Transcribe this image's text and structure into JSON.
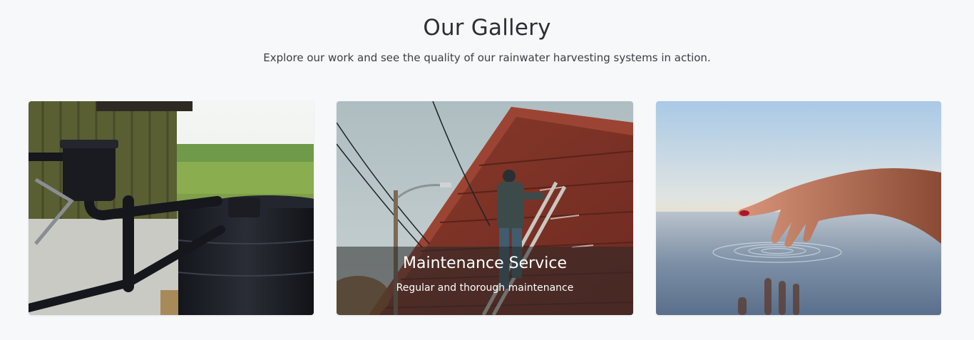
{
  "gallery": {
    "title": "Our Gallery",
    "subtitle": "Explore our work and see the quality of our rainwater harvesting systems in action.",
    "items": [
      {
        "image": "rainwater-tank-photo"
      },
      {
        "image": "house-maintenance-photo",
        "caption_title": "Maintenance Service",
        "caption_text": "Regular and thorough maintenance"
      },
      {
        "image": "hand-touching-water-photo"
      }
    ]
  }
}
